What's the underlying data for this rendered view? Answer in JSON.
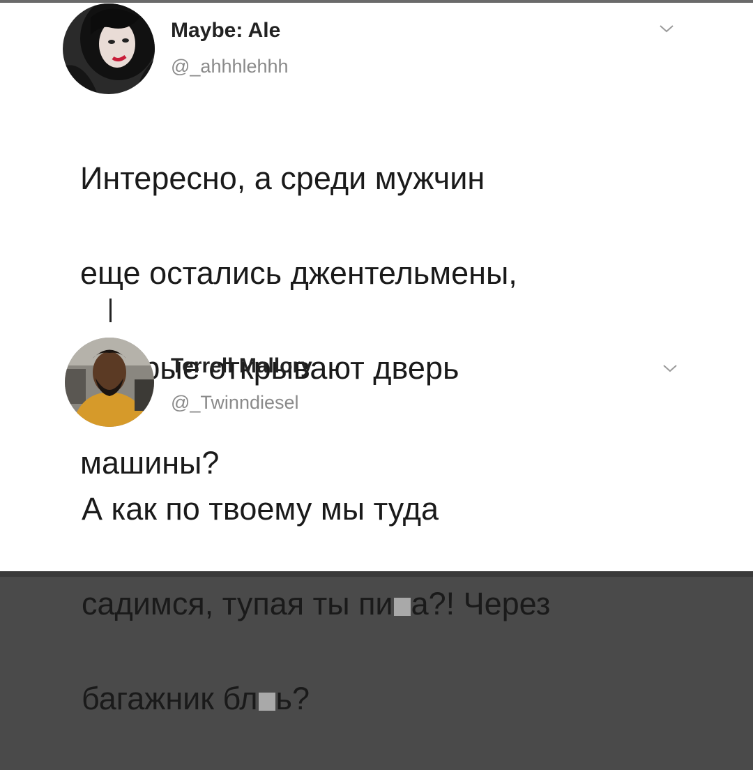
{
  "tweets": [
    {
      "display_name": "Maybe: Ale",
      "handle": "@_ahhhlehhh",
      "avatar_icon": "user-avatar-woman",
      "menu_icon": "chevron-down-icon",
      "lines": [
        "Интересно, а среди мужчин",
        "еще остались джентельмены,",
        "которые открывают дверь",
        "машины?"
      ]
    },
    {
      "display_name": "Terrell Mallory",
      "handle": "@_Twinndiesel",
      "avatar_icon": "user-avatar-man",
      "menu_icon": "chevron-down-icon",
      "lines": [
        "А как по твоему мы туда",
        "садимся, тупая ты пи",
        "а?! Через",
        "багажник бл",
        "ь?"
      ]
    }
  ],
  "colors": {
    "text": "#1a1a1a",
    "handle": "#8a8a8a",
    "censor": "#a9a9a9"
  }
}
